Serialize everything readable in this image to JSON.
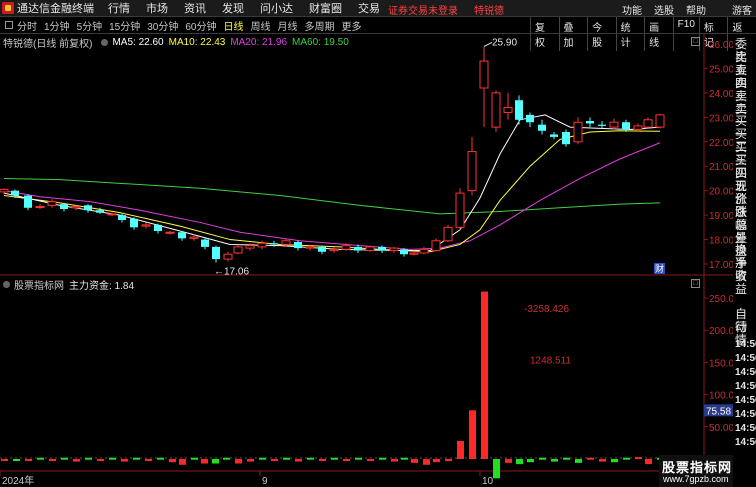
{
  "app": {
    "title": "通达信金融终端",
    "menus": [
      "行情",
      "市场",
      "资讯",
      "发现",
      "问小达",
      "财富圈",
      "交易"
    ],
    "notice": "证券交易未登录",
    "stock_name": "特锐德",
    "right_menu": [
      "功能",
      "选股",
      "帮助",
      "游客"
    ]
  },
  "toolbar": {
    "periods": [
      "分时",
      "1分钟",
      "5分钟",
      "15分钟",
      "30分钟",
      "60分钟",
      "日线",
      "周线",
      "月线",
      "多周期",
      "更多"
    ],
    "active_period": "日线",
    "buttons": [
      "复权",
      "叠加",
      "今股",
      "统计",
      "画线",
      "F10",
      "标记",
      "返回"
    ]
  },
  "kline": {
    "title": "特锐德(日线 前复权)",
    "ma": [
      {
        "label": "MA5: 22.60",
        "color": "#ffffff"
      },
      {
        "label": "MA10: 22.43",
        "color": "#ffff40"
      },
      {
        "label": "MA20: 21.96",
        "color": "#e040e0"
      },
      {
        "label": "MA60: 19.50",
        "color": "#40d040"
      }
    ],
    "yticks": [
      "26.00",
      "25.00",
      "24.00",
      "23.00",
      "22.00",
      "21.00",
      "20.00",
      "19.00",
      "18.00",
      "17.00"
    ],
    "high_label": "25.90",
    "low_label": "17.06",
    "finance_marker": "财"
  },
  "indicator": {
    "title": "股票指标网",
    "label": "主力资金: 1.84",
    "yticks": [
      "250.0",
      "200.0",
      "150.0",
      "100.0",
      "50.00",
      "0.00"
    ],
    "annot1": "-3258.426",
    "annot2": "1248.511",
    "current": "75.58"
  },
  "xaxis": {
    "labels": [
      "2024年",
      "9",
      "10"
    ]
  },
  "side_panel": {
    "items": [
      "委比",
      "卖五",
      "卖四",
      "卖三",
      "卖二",
      "卖一",
      "买一",
      "买二",
      "买三",
      "买四",
      "买五",
      "现价",
      "涨跌",
      "涨幅",
      "总量",
      "外盘",
      "换手",
      "净资",
      "收益"
    ],
    "lower_title": [
      "自动",
      "行情"
    ],
    "times": [
      "14:56",
      "14:56",
      "14:56",
      "14:56",
      "14:56",
      "14:56",
      "14:56",
      "14:56"
    ]
  },
  "watermark": {
    "name": "股票指标网",
    "url": "www.7gpzb.com"
  }
}
